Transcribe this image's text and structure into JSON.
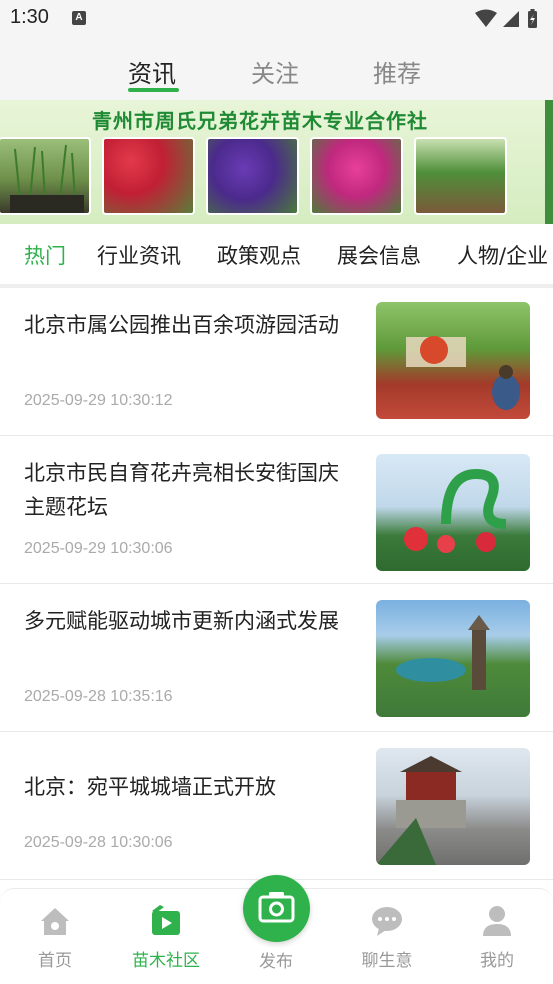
{
  "status_bar": {
    "time": "1:30",
    "notification_icon": "A"
  },
  "top_tabs": [
    {
      "label": "资讯",
      "active": true
    },
    {
      "label": "关注",
      "active": false
    },
    {
      "label": "推荐",
      "active": false
    }
  ],
  "banner": {
    "title": "青州市周氏兄弟花卉苗木专业合作社"
  },
  "category_tabs": [
    {
      "label": "热门",
      "active": true
    },
    {
      "label": "行业资讯",
      "active": false
    },
    {
      "label": "政策观点",
      "active": false
    },
    {
      "label": "展会信息",
      "active": false
    },
    {
      "label": "人物/企业",
      "active": false
    }
  ],
  "news": [
    {
      "title": "北京市属公园推出百余项游园活动",
      "time": "2025-09-29 10:30:12"
    },
    {
      "title": "北京市民自育花卉亮相长安街国庆主题花坛",
      "time": "2025-09-29 10:30:06"
    },
    {
      "title": "多元赋能驱动城市更新内涵式发展",
      "time": "2025-09-28 10:35:16"
    },
    {
      "title": "北京：宛平城城墙正式开放",
      "time": "2025-09-28 10:30:06"
    }
  ],
  "bottom_nav": {
    "items": [
      {
        "label": "首页",
        "icon": "home-icon",
        "active": false
      },
      {
        "label": "苗木社区",
        "icon": "video-icon",
        "active": true
      },
      {
        "label": "聊生意",
        "icon": "chat-icon",
        "active": false
      },
      {
        "label": "我的",
        "icon": "user-icon",
        "active": false
      }
    ],
    "publish_label": "发布"
  },
  "colors": {
    "accent": "#2fb24c",
    "text": "#222222",
    "muted": "#999999"
  }
}
